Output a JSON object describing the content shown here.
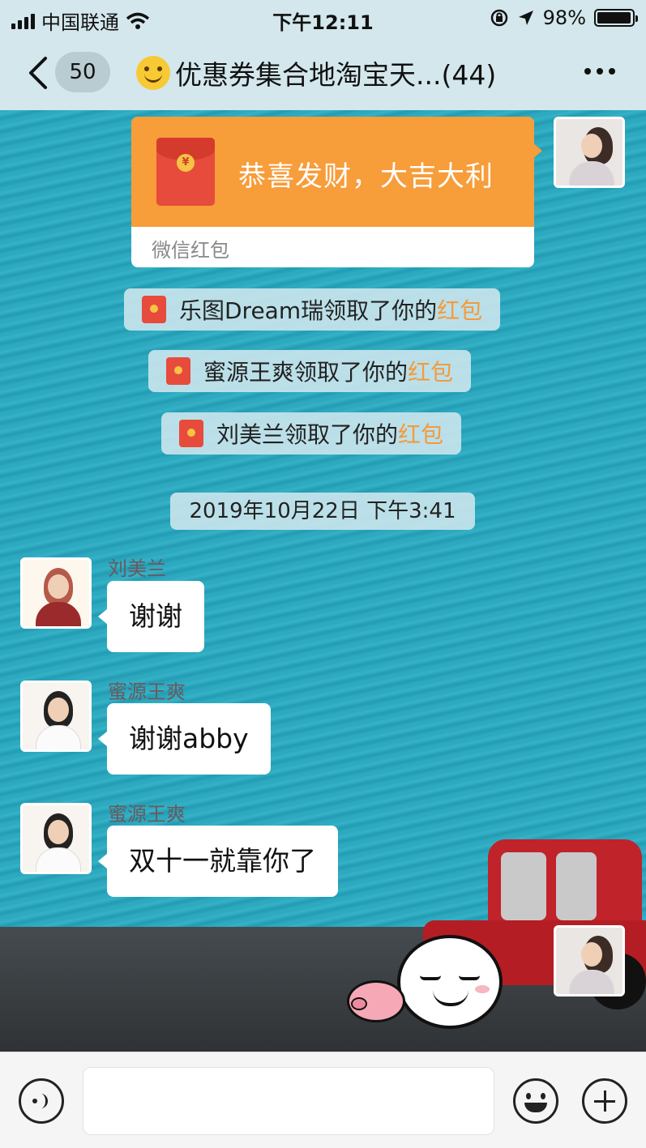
{
  "status_bar": {
    "carrier": "中国联通",
    "time": "下午12:11",
    "battery": "98%",
    "battery_level": 0.98
  },
  "nav": {
    "back_count": "50",
    "title": "优惠券集合地淘宝天...(44)"
  },
  "red_packet": {
    "text": "恭喜发财，大吉大利",
    "footer": "微信红包",
    "currency_symbol": "¥"
  },
  "notices": [
    {
      "name": "乐图Dream瑞",
      "text": "领取了你的",
      "link": "红包"
    },
    {
      "name": "蜜源王爽",
      "text": "领取了你的",
      "link": "红包"
    },
    {
      "name": "刘美兰",
      "text": "领取了你的",
      "link": "红包"
    }
  ],
  "timestamp": "2019年10月22日 下午3:41",
  "messages": [
    {
      "sender": "刘美兰",
      "text": "谢谢"
    },
    {
      "sender": "蜜源王爽",
      "text": "谢谢abby"
    },
    {
      "sender": "蜜源王爽",
      "text": "双十一就靠你了"
    }
  ],
  "colors": {
    "accent_orange": "#f79d3a",
    "link_orange": "#f49a3c",
    "chat_background": "#2aa7bd",
    "header_background": "#d3e7ec"
  },
  "icons": {
    "back": "chevron-left-icon",
    "more": "more-dots-icon",
    "voice": "voice-icon",
    "emoji": "emoji-icon",
    "plus": "plus-icon"
  }
}
